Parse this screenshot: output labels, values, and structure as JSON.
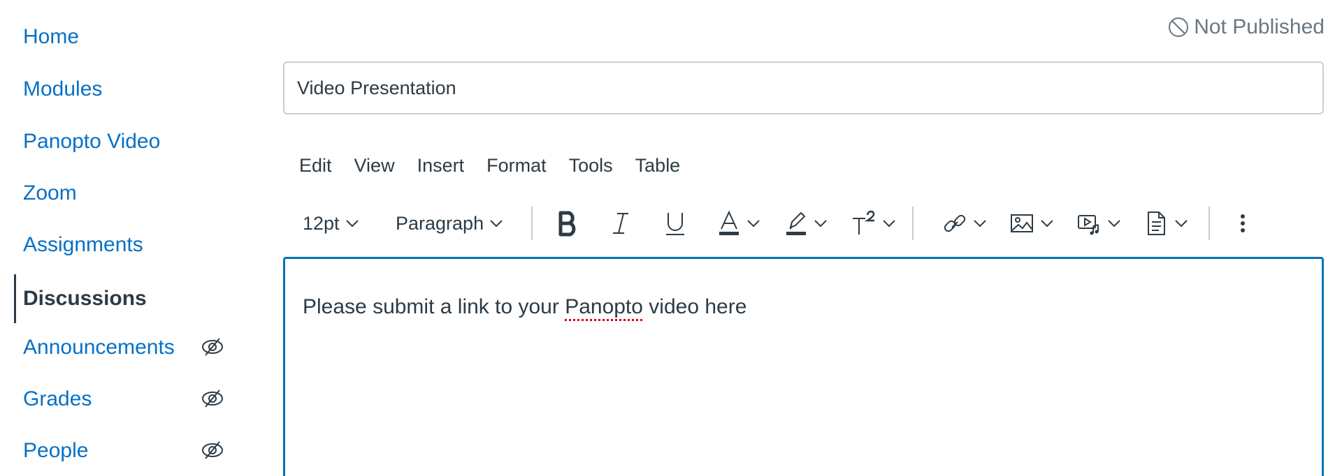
{
  "sidebar": {
    "items": [
      {
        "label": "Home",
        "active": false,
        "hidden": false
      },
      {
        "label": "Modules",
        "active": false,
        "hidden": false
      },
      {
        "label": "Panopto Video",
        "active": false,
        "hidden": false
      },
      {
        "label": "Zoom",
        "active": false,
        "hidden": false
      },
      {
        "label": "Assignments",
        "active": false,
        "hidden": false
      },
      {
        "label": "Discussions",
        "active": true,
        "hidden": false
      },
      {
        "label": "Announcements",
        "active": false,
        "hidden": true
      },
      {
        "label": "Grades",
        "active": false,
        "hidden": true
      },
      {
        "label": "People",
        "active": false,
        "hidden": true
      }
    ]
  },
  "status": {
    "label": "Not Published",
    "icon": "not-published-icon"
  },
  "title_input": {
    "value": "Video Presentation"
  },
  "menubar": {
    "items": [
      "Edit",
      "View",
      "Insert",
      "Format",
      "Tools",
      "Table"
    ]
  },
  "toolbar": {
    "font_size": "12pt",
    "block_format": "Paragraph",
    "buttons": [
      "bold-icon",
      "italic-icon",
      "underline-icon",
      "text-color-icon",
      "highlight-icon",
      "superscript-icon",
      "link-icon",
      "image-icon",
      "media-icon",
      "document-icon",
      "more-icon"
    ]
  },
  "editor": {
    "text_before": "Please submit a link to your ",
    "misspelled": "Panopto",
    "text_after": " video here"
  },
  "colors": {
    "link": "#0770c4",
    "text": "#2d3b45",
    "focus_border": "#0374b5",
    "muted": "#6b7780"
  }
}
